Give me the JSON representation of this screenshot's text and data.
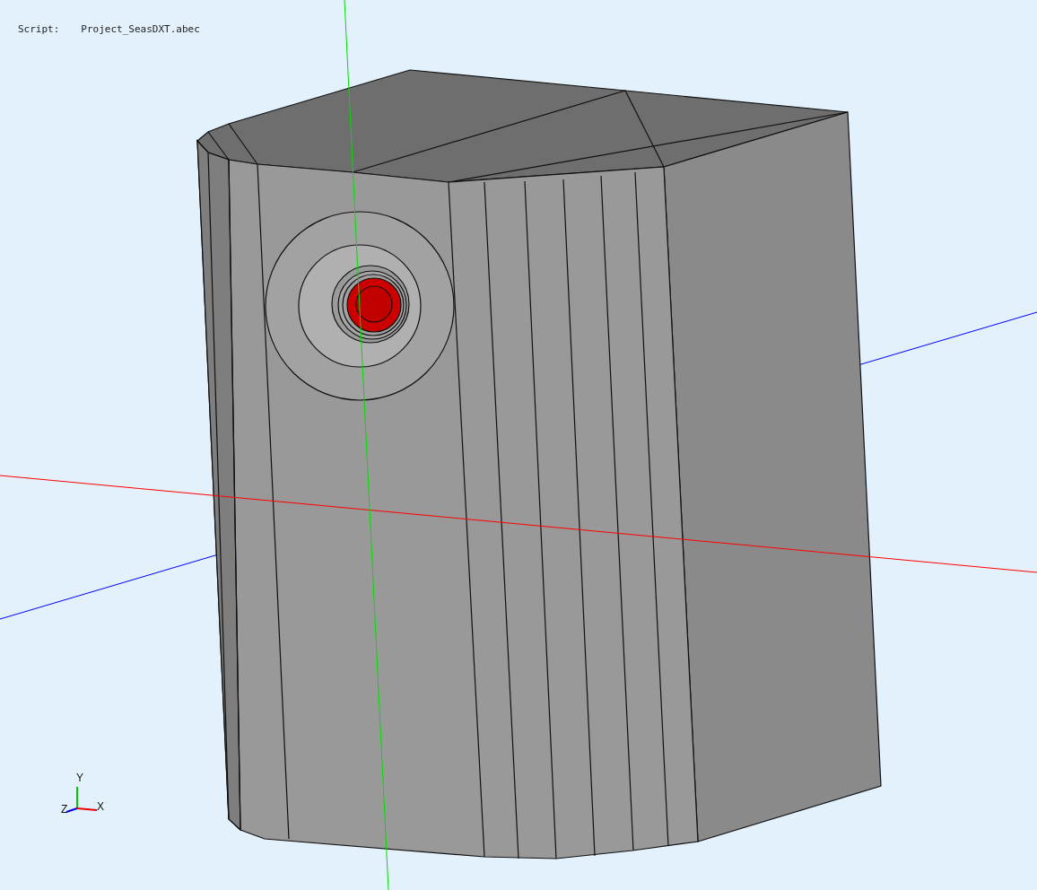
{
  "header": {
    "label": "Script:",
    "value": "Project_SeasDXT.abec"
  },
  "triad": {
    "labels": [
      "Y",
      "Z",
      "X"
    ]
  }
}
